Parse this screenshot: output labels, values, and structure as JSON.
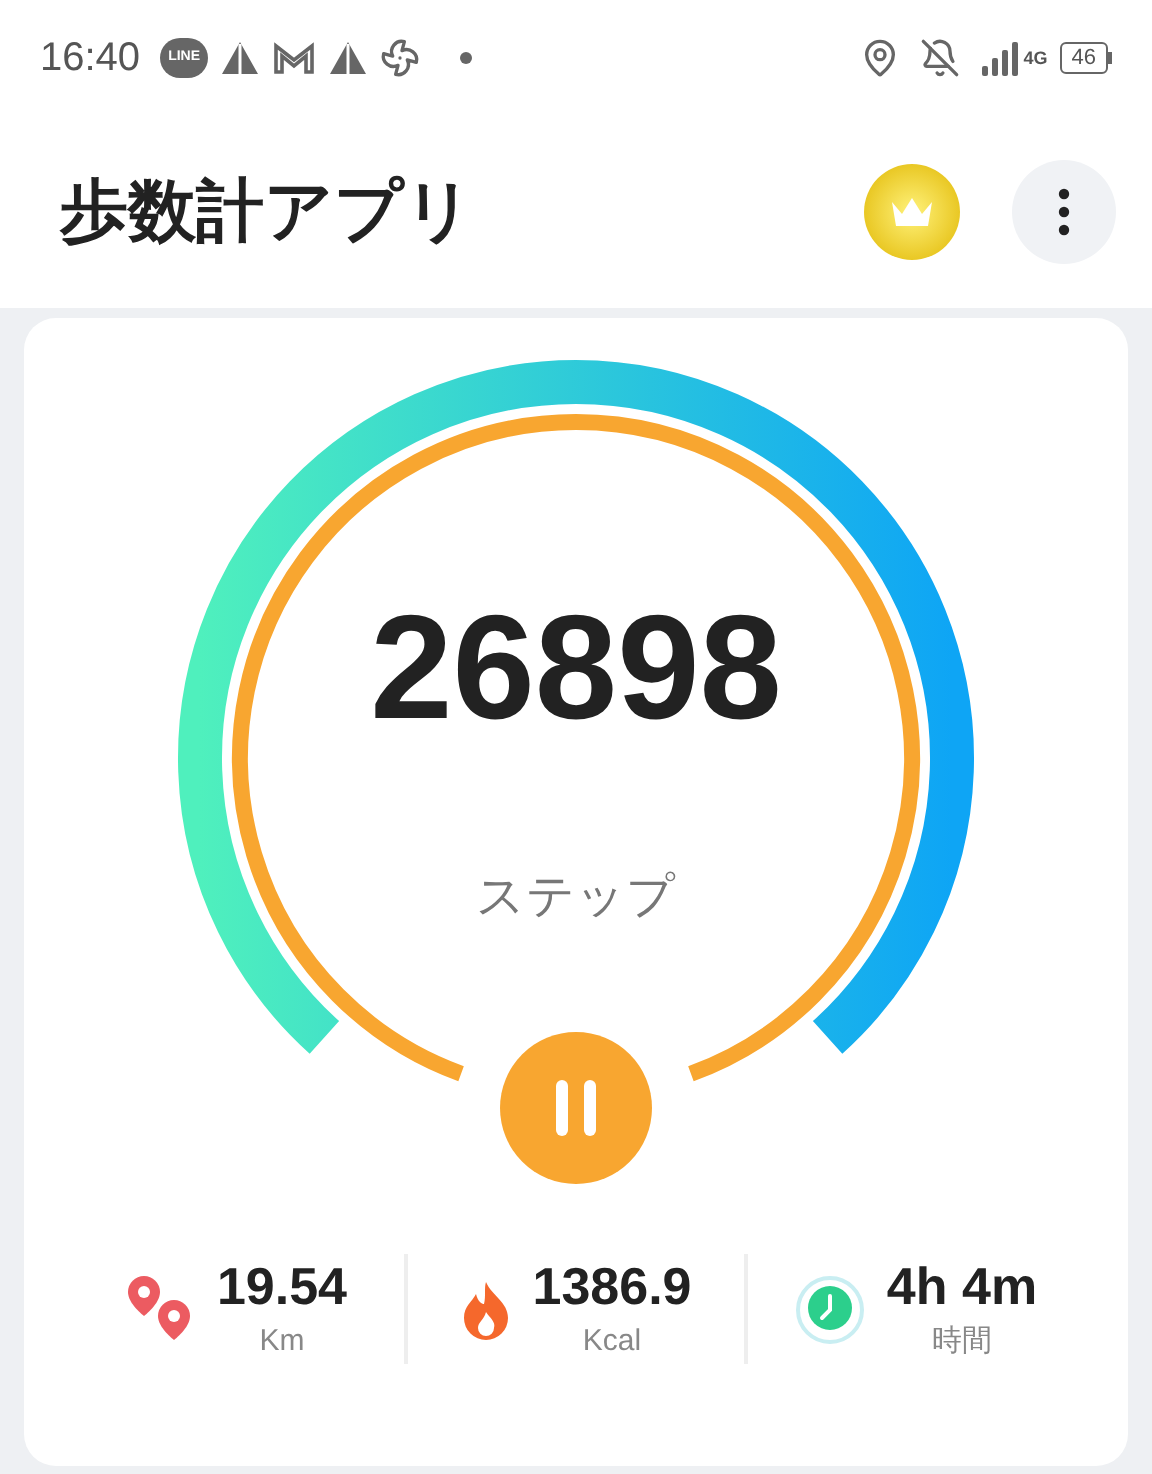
{
  "status_bar": {
    "time": "16:40",
    "line_label": "LINE",
    "network": "4G",
    "battery": "46"
  },
  "header": {
    "title": "歩数計アプリ"
  },
  "counter": {
    "steps": "26898",
    "unit": "ステップ",
    "paused": false
  },
  "stats": [
    {
      "kind": "distance",
      "value": "19.54",
      "unit": "Km"
    },
    {
      "kind": "calories",
      "value": "1386.9",
      "unit": "Kcal"
    },
    {
      "kind": "time",
      "value": "4h 4m",
      "unit": "時間"
    }
  ]
}
